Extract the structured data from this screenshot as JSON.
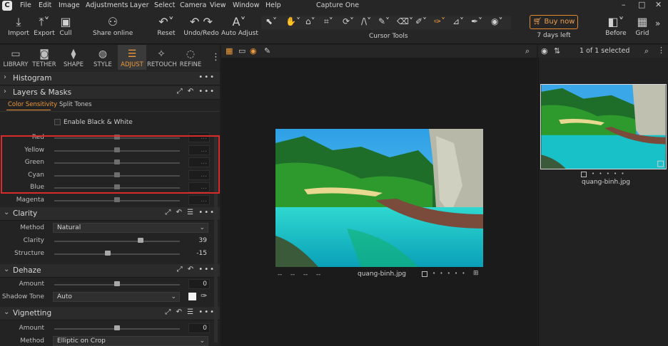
{
  "menu": {
    "items": [
      "File",
      "Edit",
      "Image",
      "Adjustments",
      "Layer",
      "Select",
      "Camera",
      "View",
      "Window",
      "Help"
    ],
    "app_title": "Capture One"
  },
  "toolbar": {
    "import": "Import",
    "export": "Export",
    "cull": "Cull",
    "share": "Share online",
    "reset": "Reset",
    "undo_redo": "Undo/Redo",
    "auto_adjust": "Auto Adjust",
    "cursor_tools": "Cursor Tools",
    "buy_now": "Buy now",
    "trial": "7 days left",
    "before": "Before",
    "grid": "Grid"
  },
  "tool_tabs": [
    "LIBRARY",
    "TETHER",
    "SHAPE",
    "STYLE",
    "ADJUST",
    "RETOUCH",
    "REFINE"
  ],
  "active_tool_tab": "ADJUST",
  "sections": {
    "histogram": "Histogram",
    "layers_masks": "Layers & Masks",
    "clarity": "Clarity",
    "dehaze": "Dehaze",
    "vignetting": "Vignetting"
  },
  "bw": {
    "tabs": [
      "Color Sensitivity",
      "Split Tones"
    ],
    "enable_label": "Enable Black & White",
    "rows": [
      {
        "label": "Red",
        "value": "..."
      },
      {
        "label": "Yellow",
        "value": "..."
      },
      {
        "label": "Green",
        "value": "..."
      },
      {
        "label": "Cyan",
        "value": "..."
      },
      {
        "label": "Blue",
        "value": "..."
      },
      {
        "label": "Magenta",
        "value": "..."
      }
    ]
  },
  "clarity": {
    "method_label": "Method",
    "method_value": "Natural",
    "clarity_label": "Clarity",
    "clarity_value": "39",
    "structure_label": "Structure",
    "structure_value": "-15"
  },
  "dehaze": {
    "amount_label": "Amount",
    "amount_value": "0",
    "shadow_tone_label": "Shadow Tone",
    "shadow_tone_value": "Auto"
  },
  "vignetting": {
    "amount_label": "Amount",
    "amount_value": "0",
    "method_label": "Method",
    "method_value": "Elliptic on Crop"
  },
  "viewer": {
    "filename": "quang-binh.jpg",
    "meta": [
      "--",
      "--",
      "--",
      "--"
    ],
    "dots": "• • • • •"
  },
  "browser": {
    "selection": "1 of 1 selected",
    "thumb_name": "quang-binh.jpg",
    "dots": "• • • • •"
  },
  "colors": {
    "accent": "#f09a3a",
    "highlight_box": "#d92b2b",
    "buy_border": "#e68a2e"
  }
}
